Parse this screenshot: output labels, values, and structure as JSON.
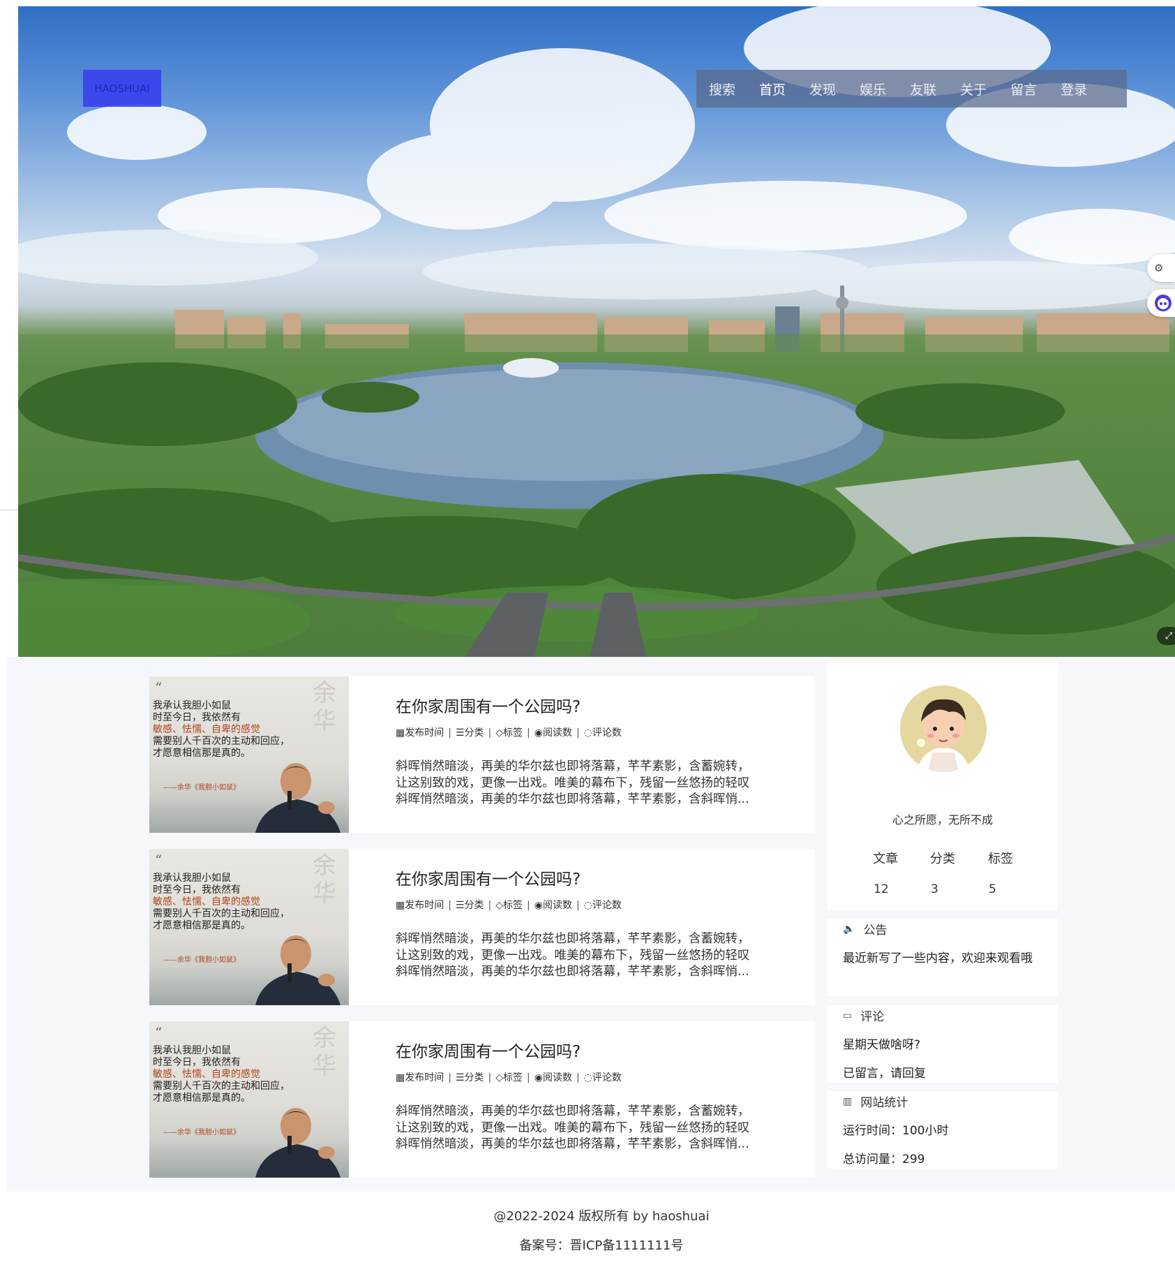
{
  "header": {
    "logo_text": "HAOSHUAI",
    "nav": [
      "搜索",
      "首页",
      "发现",
      "娱乐",
      "友联",
      "关于",
      "留言",
      "登录"
    ]
  },
  "side_buttons": {
    "top_icon": "settings-icon",
    "bottom_icon": "robot-icon"
  },
  "hero": {
    "expand_icon": "expand-icon"
  },
  "posts": [
    {
      "title": "在你家周围有一个公园吗?",
      "meta": {
        "date": "发布时间",
        "category": "分类",
        "tags": "标签",
        "views": "阅读数",
        "comments": "评论数"
      },
      "excerpt": [
        "斜晖悄然暗淡，再美的华尔兹也即将落幕，芊芊素影，含蓄婉转，",
        "让这别致的戏，更像一出戏。唯美的幕布下，残留一丝悠扬的轻叹",
        "斜晖悄然暗淡，再美的华尔兹也即将落幕，芊芊素影，含斜晖悄..."
      ],
      "thumb": {
        "big": "余华",
        "lines": [
          "我承认我胆小如鼠",
          "时至今日，我依然有",
          "敏感、怯懦、自卑的感觉",
          "需要别人千百次的主动和回应，",
          "才愿意相信那是真的。"
        ],
        "sign": "——余华《我胆小如鼠》"
      }
    },
    {
      "title": "在你家周围有一个公园吗?",
      "meta": {
        "date": "发布时间",
        "category": "分类",
        "tags": "标签",
        "views": "阅读数",
        "comments": "评论数"
      },
      "excerpt": [
        "斜晖悄然暗淡，再美的华尔兹也即将落幕，芊芊素影，含蓄婉转，",
        "让这别致的戏，更像一出戏。唯美的幕布下，残留一丝悠扬的轻叹",
        "斜晖悄然暗淡，再美的华尔兹也即将落幕，芊芊素影，含斜晖悄..."
      ],
      "thumb": {
        "big": "余华",
        "lines": [
          "我承认我胆小如鼠",
          "时至今日，我依然有",
          "敏感、怯懦、自卑的感觉",
          "需要别人千百次的主动和回应，",
          "才愿意相信那是真的。"
        ],
        "sign": "——余华《我胆小如鼠》"
      }
    },
    {
      "title": "在你家周围有一个公园吗?",
      "meta": {
        "date": "发布时间",
        "category": "分类",
        "tags": "标签",
        "views": "阅读数",
        "comments": "评论数"
      },
      "excerpt": [
        "斜晖悄然暗淡，再美的华尔兹也即将落幕，芊芊素影，含蓄婉转，",
        "让这别致的戏，更像一出戏。唯美的幕布下，残留一丝悠扬的轻叹",
        "斜晖悄然暗淡，再美的华尔兹也即将落幕，芊芊素影，含斜晖悄..."
      ],
      "thumb": {
        "big": "余华",
        "lines": [
          "我承认我胆小如鼠",
          "时至今日，我依然有",
          "敏感、怯懦、自卑的感觉",
          "需要别人千百次的主动和回应，",
          "才愿意相信那是真的。"
        ],
        "sign": "——余华《我胆小如鼠》"
      }
    }
  ],
  "profile": {
    "motto": "心之所愿，无所不成",
    "stats": [
      {
        "label": "文章",
        "value": "12"
      },
      {
        "label": "分类",
        "value": "3"
      },
      {
        "label": "标签",
        "value": "5"
      }
    ]
  },
  "notice": {
    "title": "公告",
    "text": "最近新写了一些内容，欢迎来观看哦"
  },
  "comments": {
    "title": "评论",
    "items": [
      "星期天做啥呀?",
      "已留言，请回复"
    ]
  },
  "site_stats": {
    "title": "网站统计",
    "runtime": "运行时间：100小时",
    "visits": "总访问量：299"
  },
  "footer": {
    "copyright": "@2022-2024 版权所有 by haoshuai",
    "icp": "备案号：晋ICP备1111111号"
  },
  "colors": {
    "page_bg": "#f6f7fb",
    "logo_box": "#3a40ee",
    "nav_bg": "#5a698c"
  }
}
